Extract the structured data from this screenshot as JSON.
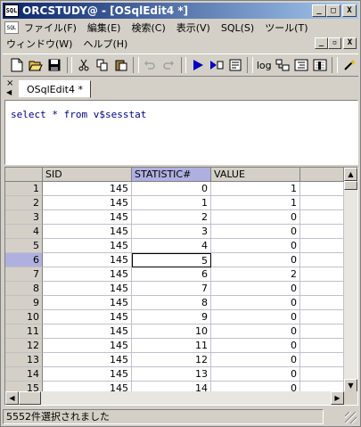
{
  "window": {
    "app_icon_text": "SQL",
    "title": "ORCSTUDY@ - [OSqlEdit4 *]",
    "minimize": "_",
    "maximize": "□",
    "close": "X"
  },
  "menu": {
    "row1": [
      "ファイル(F)",
      "編集(E)",
      "検索(C)",
      "表示(V)",
      "SQL(S)",
      "ツール(T)"
    ],
    "row2": [
      "ウィンドウ(W)",
      "ヘルプ(H)"
    ],
    "mdi": {
      "minimize": "_",
      "restore": "▫",
      "close": "X"
    }
  },
  "toolbar": {
    "icons": [
      "new-icon",
      "open-icon",
      "save-icon",
      "cut-icon",
      "copy-icon",
      "paste-icon",
      "undo-icon",
      "redo-icon",
      "execute-icon",
      "execute-step-icon",
      "explain-icon",
      "log-icon",
      "describe-icon",
      "format-icon",
      "settings-icon",
      "wand-icon"
    ],
    "log_label": "log"
  },
  "tabs": {
    "close": "×",
    "prev": "◀",
    "active": "OSqlEdit4 *"
  },
  "editor": {
    "sql": "select * from v$sesstat"
  },
  "grid": {
    "columns": [
      "SID",
      "STATISTIC#",
      "VALUE"
    ],
    "selected_column": "STATISTIC#",
    "current_row": 6,
    "rows": [
      [
        "1",
        "145",
        "0",
        "1"
      ],
      [
        "2",
        "145",
        "1",
        "1"
      ],
      [
        "3",
        "145",
        "2",
        "0"
      ],
      [
        "4",
        "145",
        "3",
        "0"
      ],
      [
        "5",
        "145",
        "4",
        "0"
      ],
      [
        "6",
        "145",
        "5",
        "0"
      ],
      [
        "7",
        "145",
        "6",
        "2"
      ],
      [
        "8",
        "145",
        "7",
        "0"
      ],
      [
        "9",
        "145",
        "8",
        "0"
      ],
      [
        "10",
        "145",
        "9",
        "0"
      ],
      [
        "11",
        "145",
        "10",
        "0"
      ],
      [
        "12",
        "145",
        "11",
        "0"
      ],
      [
        "13",
        "145",
        "12",
        "0"
      ],
      [
        "14",
        "145",
        "13",
        "0"
      ],
      [
        "15",
        "145",
        "14",
        "0"
      ]
    ],
    "scroll": {
      "up": "▲",
      "down": "▼",
      "left": "◀",
      "right": "▶"
    }
  },
  "status": {
    "text": "5552件選択されました"
  }
}
